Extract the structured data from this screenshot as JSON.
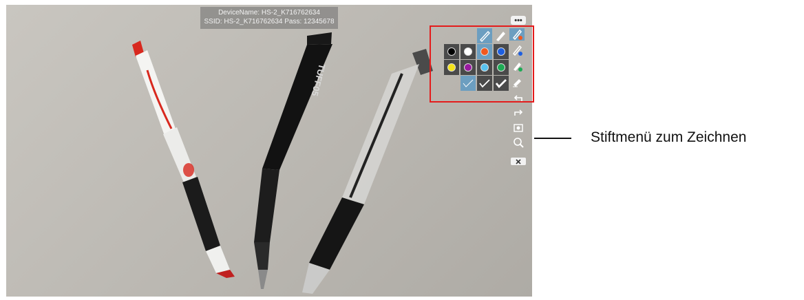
{
  "device_info": {
    "line1": "DeviceName: HS-2_K716762634",
    "line2": "SSID: HS-2_K716762634   Pass: 12345678"
  },
  "toolbar": {
    "more_label": "•••",
    "icons": [
      "more-icon",
      "pen-thin-icon",
      "pen-marker-icon",
      "pen-color-icon",
      "undo-icon",
      "redo-icon",
      "snapshot-icon",
      "zoom-icon",
      "close-icon"
    ]
  },
  "pen_menu": {
    "colors": [
      "#000000",
      "#ffffff",
      "#f2581e",
      "#1e5fe0",
      "#f5e31a",
      "#9a1aa0",
      "#58c3f0",
      "#1eaa55"
    ],
    "stroke_widths": [
      "thin",
      "medium",
      "thick"
    ],
    "selected_tool": "pen-thin",
    "selected_width": "thin"
  },
  "pen_labels": {
    "brand": "TUFF05"
  },
  "annotation": {
    "caption": "Stiftmenü zum Zeichnen"
  }
}
